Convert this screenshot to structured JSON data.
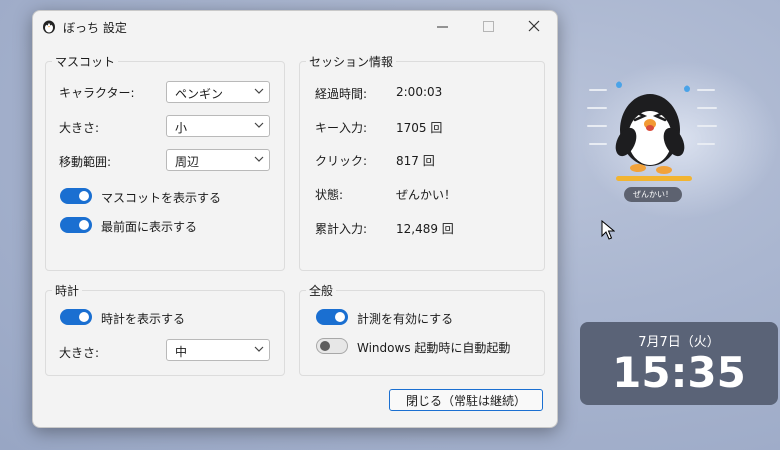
{
  "window": {
    "title": "ぼっち 設定",
    "controls": {
      "minimize": "—",
      "maximize": "☐",
      "close": "✕"
    }
  },
  "mascot_group": {
    "title": "マスコット",
    "character": {
      "label": "キャラクター:",
      "value": "ペンギン"
    },
    "size": {
      "label": "大きさ:",
      "value": "小"
    },
    "range": {
      "label": "移動範囲:",
      "value": "周辺"
    },
    "show_mascot": {
      "label": "マスコットを表示する",
      "on": true
    },
    "always_on_top": {
      "label": "最前面に表示する",
      "on": true
    }
  },
  "session_group": {
    "title": "セッション情報",
    "rows": [
      {
        "label": "経過時間:",
        "value": "2:00:03"
      },
      {
        "label": "キー入力:",
        "value": "1705 回"
      },
      {
        "label": "クリック:",
        "value": "817 回"
      },
      {
        "label": "状態:",
        "value": "ぜんかい！"
      },
      {
        "label": "累計入力:",
        "value": "12,489 回"
      }
    ]
  },
  "clock_group": {
    "title": "時計",
    "show_clock": {
      "label": "時計を表示する",
      "on": true
    },
    "size": {
      "label": "大きさ:",
      "value": "中"
    }
  },
  "general_group": {
    "title": "全般",
    "enable_measure": {
      "label": "計測を有効にする",
      "on": true
    },
    "autostart": {
      "label": "Windows 起動時に自動起動",
      "on": false
    }
  },
  "close_button": {
    "label": "閉じる（常駐は継続）"
  },
  "desktop_mascot": {
    "status": "ぜんかい！",
    "energy_fraction": 1.0,
    "colors": {
      "bar": "#f2b431"
    }
  },
  "clock_widget": {
    "date": "7月7日（火）",
    "time": "15:35"
  },
  "colors": {
    "accent": "#1a6fd1"
  }
}
